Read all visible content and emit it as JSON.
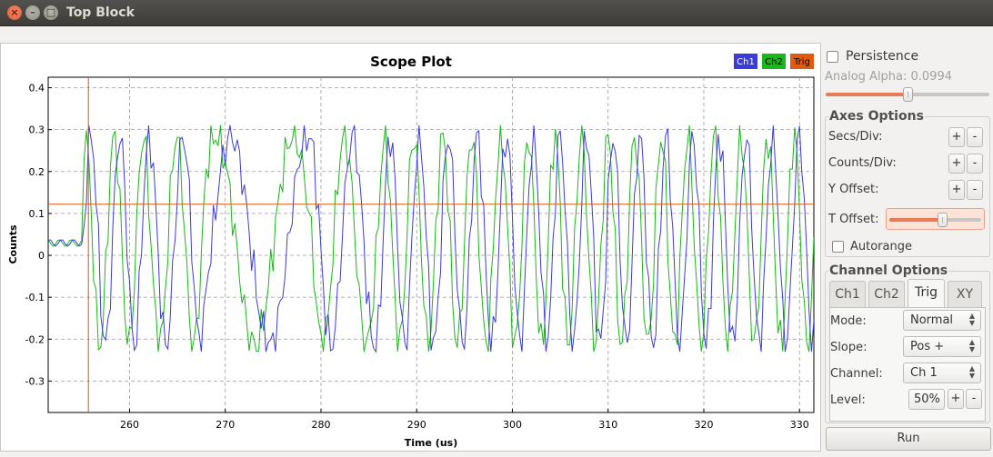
{
  "window": {
    "title": "Top Block"
  },
  "plot": {
    "title": "Scope Plot",
    "legend": [
      {
        "label": "Ch1",
        "color": "#3b3bdb"
      },
      {
        "label": "Ch2",
        "color": "#18b818"
      },
      {
        "label": "Trig",
        "color": "#e05a10"
      }
    ]
  },
  "chart_data": {
    "type": "line",
    "title": "Scope Plot",
    "xlabel": "Time (us)",
    "ylabel": "Counts",
    "xlim": [
      251.5,
      331.5
    ],
    "ylim": [
      -0.375,
      0.425
    ],
    "xticks": [
      "260",
      "270",
      "280",
      "290",
      "300",
      "310",
      "320",
      "330"
    ],
    "yticks": [
      "0.4",
      "0.3",
      "0.2",
      "0.1",
      "0",
      "-0.1",
      "-0.2",
      "-0.3"
    ],
    "grid": true,
    "legend_position": "top-right",
    "trigger": {
      "time": 255.7,
      "level": 0.122
    },
    "series": [
      {
        "name": "Ch1",
        "color": "#3b3bdb"
      },
      {
        "name": "Ch2",
        "color": "#18b818"
      },
      {
        "name": "Trig",
        "color": "#e05a10"
      }
    ]
  },
  "panel": {
    "persistence_label": "Persistence",
    "analog_alpha_label": "Analog Alpha: 0.0994",
    "analog_alpha_value": 0.5,
    "axes_group_title": "Axes Options",
    "secs_div_label": "Secs/Div:",
    "counts_div_label": "Counts/Div:",
    "y_offset_label": "Y Offset:",
    "t_offset_label": "T Offset:",
    "t_offset_value": 0.57,
    "autorange_label": "Autorange",
    "plus": "+",
    "minus": "-",
    "channel_group_title": "Channel Options",
    "tabs": [
      "Ch1",
      "Ch2",
      "Trig",
      "XY"
    ],
    "active_tab": "Trig",
    "mode_label": "Mode:",
    "mode_value": "Normal",
    "slope_label": "Slope:",
    "slope_value": "Pos +",
    "channel_label": "Channel:",
    "channel_value": "Ch 1",
    "level_label": "Level:",
    "level_value": "50%",
    "run_label": "Run"
  }
}
